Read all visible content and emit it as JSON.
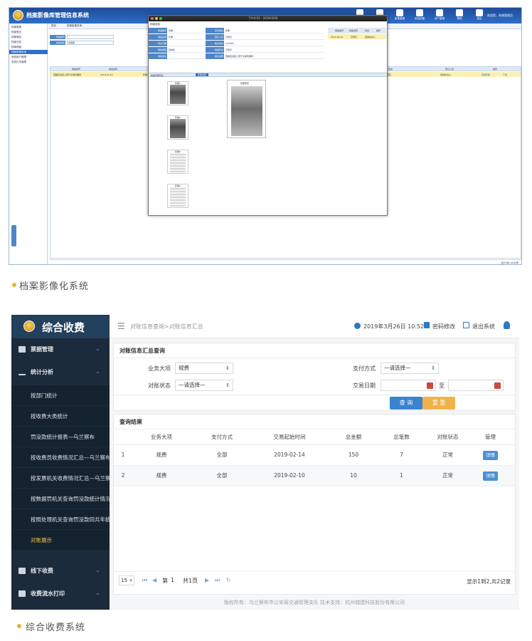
{
  "screen1": {
    "title": "档案影像库管理信息系统",
    "toolbar": [
      "查询统计",
      "档案借阅",
      "影像管理",
      "系统设置",
      "用户管理",
      "帮助",
      "退出"
    ],
    "user": "欢迎您，系统管理员",
    "sidebar": [
      "档案管理",
      "档案登记",
      "档案借阅",
      "档案归还",
      "档案销毁",
      "档案影像查询",
      "系统用户管理",
      "系统日志管理"
    ],
    "tabs": [
      "首页",
      "档案影像查询"
    ],
    "form_labels": [
      "档案编号",
      "档案类型"
    ],
    "form_select": "请选择",
    "grid_head": [
      "档案编号",
      "档案名称",
      "档案类型",
      "登记时间",
      "状态",
      "登记人员",
      "操作"
    ],
    "grid_row": [
      "西藏自治区公安厅交通管理局",
      "2019-02-14",
      "影像",
      "已登记",
      "自动化办公",
      "查看影像",
      "下载"
    ],
    "pager": "显示1到1,共1记录",
    "popup": {
      "time": "下午4:51 · 2019/3/26",
      "header": "档案信息",
      "left_labels": [
        "档案编号",
        "档案名称",
        "登记日期",
        "档案类型",
        "档案备注"
      ],
      "left_values": [
        "影像",
        "影像",
        "",
        "自动化",
        ""
      ],
      "right_labels": [
        "登记单位",
        "登记人员",
        "联系电话",
        "档案状态",
        "备注说明"
      ],
      "right_values": [
        "影像",
        "已登记",
        "123456",
        "已登记",
        "西藏自治区公安厅交通管理局"
      ],
      "side_head": [
        "档案编号",
        "档案名称",
        "状态",
        "操作"
      ],
      "image_strip": "档案影像列表",
      "image_tab": "影像浏览",
      "thumb_labels": [
        "影像1",
        "影像2",
        "影像3",
        "影像4"
      ],
      "big_label": "影像预览"
    }
  },
  "caption1": "档案影像化系统",
  "screen2": {
    "brand": "综合收费",
    "sidebar": {
      "groups": [
        "票据管理",
        "统计分析",
        "线下收费",
        "收费流水打印"
      ],
      "subitems": [
        "按部门统计",
        "按收费大类统计",
        "罚没款统计报表—乌兰察布",
        "按收费员收费情况汇总—乌兰察布",
        "按发票机关收费情况汇总—乌兰察布",
        "按数据罚机关查询罚没款统计情况",
        "按照处理机关查询罚没款同共年统",
        "对账展示"
      ]
    },
    "breadcrumb": "对账信息查询>对账信息汇总",
    "datetime": "2019年3月26日 10:52",
    "change_password": "密码修改",
    "logout": "退出系统",
    "query": {
      "title": "对账信息汇总查询",
      "biz_label": "业务大项",
      "biz_value": "规费",
      "pay_label": "支付方式",
      "pay_value": "—请选择—",
      "state_label": "对账状态",
      "state_value": "—请选择—",
      "date_label": "交易日期",
      "to": "至",
      "search_btn": "查 询",
      "reset_btn": "重 置"
    },
    "results": {
      "title": "查询结果",
      "columns": [
        "业务大项",
        "支付方式",
        "交易起始时间",
        "总金额",
        "总笔数",
        "对账状态",
        "管理"
      ],
      "rows": [
        {
          "no": "1",
          "biz": "规费",
          "pay": "全部",
          "time": "2019-02-14",
          "amount": "150",
          "count": "7",
          "state": "正常",
          "op": "详情"
        },
        {
          "no": "2",
          "biz": "规费",
          "pay": "全部",
          "time": "2019-02-10",
          "amount": "10",
          "count": "1",
          "state": "正常",
          "op": "详情"
        }
      ]
    },
    "pager": {
      "size": "15 ÷",
      "page_label": "第",
      "page": "1",
      "total": "共1页",
      "summary": "显示1到2,共2记录"
    },
    "footer": "版权所有：乌兰察布市公安局交通管理支队 技术支持：杭州城建科技股份有限公司"
  },
  "caption2": "综合收费系统"
}
